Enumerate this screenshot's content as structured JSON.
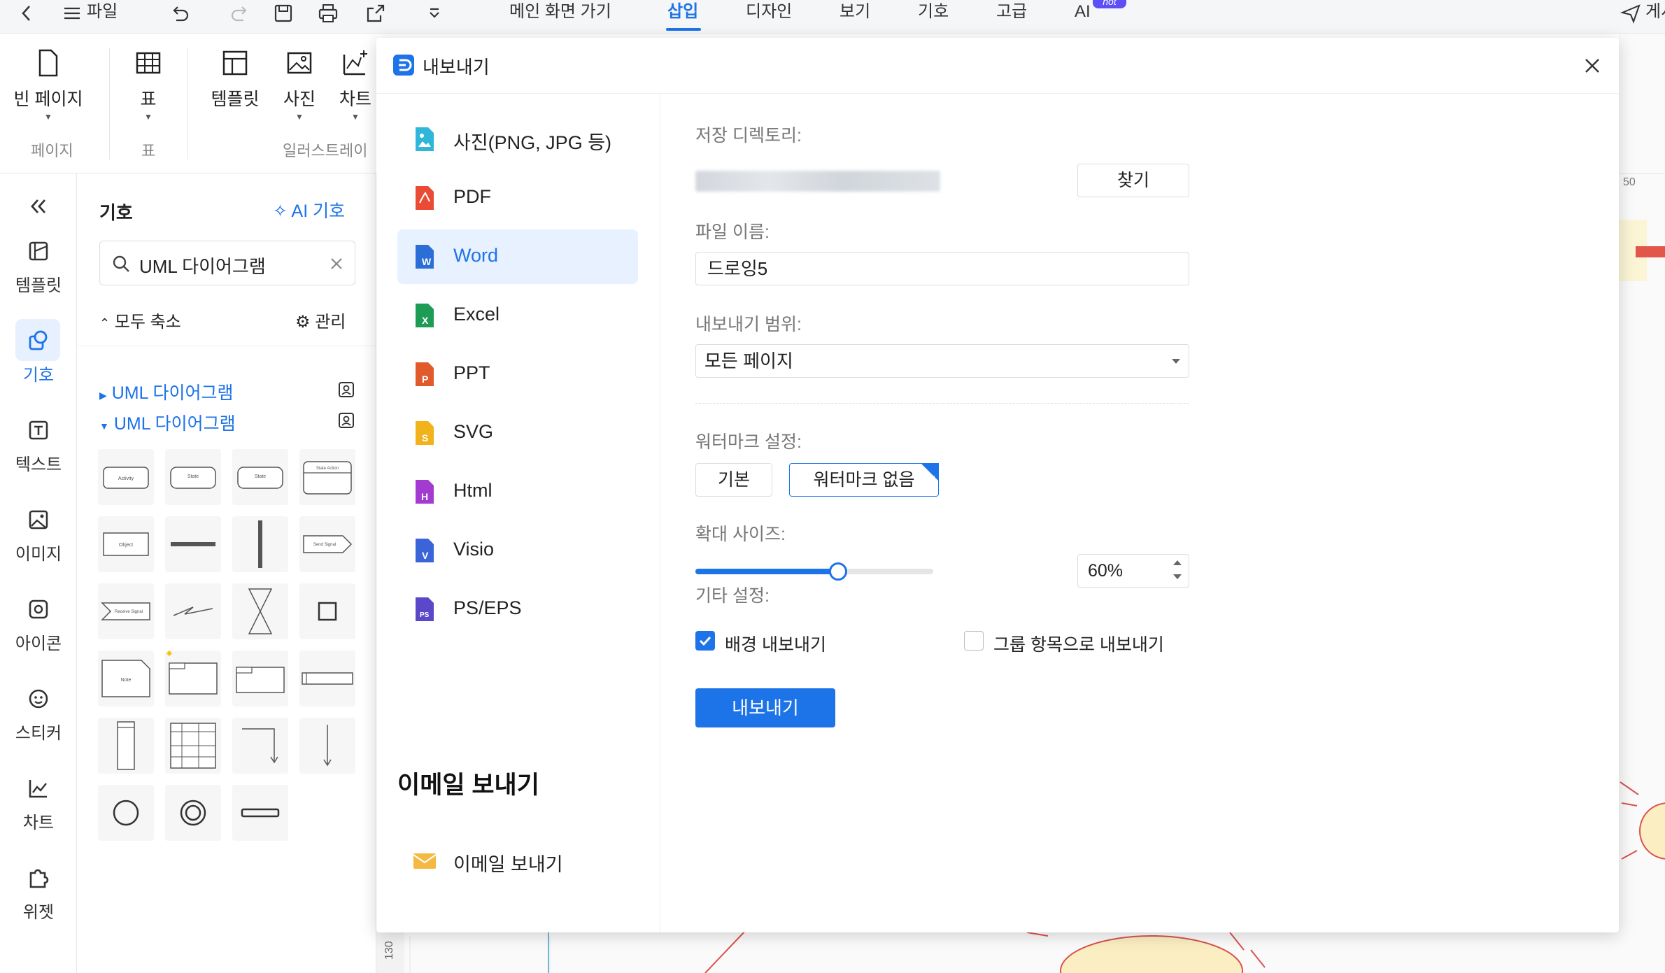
{
  "topbar": {
    "file_label": "파일",
    "tabs": [
      "메인 화면 가기",
      "삽입",
      "디자인",
      "보기",
      "기호",
      "고급",
      "AI"
    ],
    "active_tab": "삽입",
    "hot_badge": "hot",
    "right_label": "게시"
  },
  "ribbon": {
    "buttons": [
      "빈 페이지",
      "표",
      "템플릿",
      "사진",
      "차트"
    ],
    "groups": [
      "페이지",
      "표",
      "일러스트레이"
    ]
  },
  "leftnav": {
    "items": [
      "템플릿",
      "기호",
      "텍스트",
      "이미지",
      "아이콘",
      "스티커",
      "차트",
      "위젯"
    ],
    "active": "기호"
  },
  "symbol_panel": {
    "title": "기호",
    "ai_label": "AI 기호",
    "search_value": "UML 다이어그램",
    "collapse_label": "모두 축소",
    "manage_label": "관리",
    "categories": [
      "UML 다이어그램",
      "UML 다이어그램"
    ],
    "shape_labels": [
      "Activity",
      "State",
      "State",
      "State Action",
      "Object",
      "Send Signal",
      "Receive Signal",
      "Note"
    ]
  },
  "canvas": {
    "ruler_v_value": "130",
    "ruler_h_value": "50"
  },
  "dialog": {
    "title": "내보내기",
    "formats": [
      {
        "label": "사진(PNG, JPG 등)",
        "icon": "image-icon",
        "color": "#2fb6d9"
      },
      {
        "label": "PDF",
        "icon": "pdf-icon",
        "color": "#e94b35"
      },
      {
        "label": "Word",
        "icon": "word-icon",
        "color": "#2b6fd6"
      },
      {
        "label": "Excel",
        "icon": "excel-icon",
        "color": "#1e9b54"
      },
      {
        "label": "PPT",
        "icon": "ppt-icon",
        "color": "#e05a2b"
      },
      {
        "label": "SVG",
        "icon": "svg-icon",
        "color": "#f2b21b"
      },
      {
        "label": "Html",
        "icon": "html-icon",
        "color": "#a43bd0"
      },
      {
        "label": "Visio",
        "icon": "visio-icon",
        "color": "#3a64d8"
      },
      {
        "label": "PS/EPS",
        "icon": "ps-icon",
        "color": "#5a48c9"
      }
    ],
    "selected_format": "Word",
    "email_heading": "이메일 보내기",
    "email_item": "이메일 보내기",
    "save_dir_label": "저장 디렉토리:",
    "find_button": "찾기",
    "filename_label": "파일 이름:",
    "filename_value": "드로잉5",
    "range_label": "내보내기 범위:",
    "range_value": "모든 페이지",
    "watermark_label": "워터마크 설정:",
    "watermark_options": [
      "기본",
      "워터마크 없음"
    ],
    "watermark_selected": "워터마크 없음",
    "scale_label": "확대 사이즈:",
    "scale_value": "60%",
    "scale_fraction": 0.6,
    "other_label": "기타 설정:",
    "bg_export_label": "배경 내보내기",
    "bg_export_checked": true,
    "group_export_label": "그룹 항목으로 내보내기",
    "group_export_checked": false,
    "export_button": "내보내기",
    "accent_color": "#1d73e8"
  }
}
